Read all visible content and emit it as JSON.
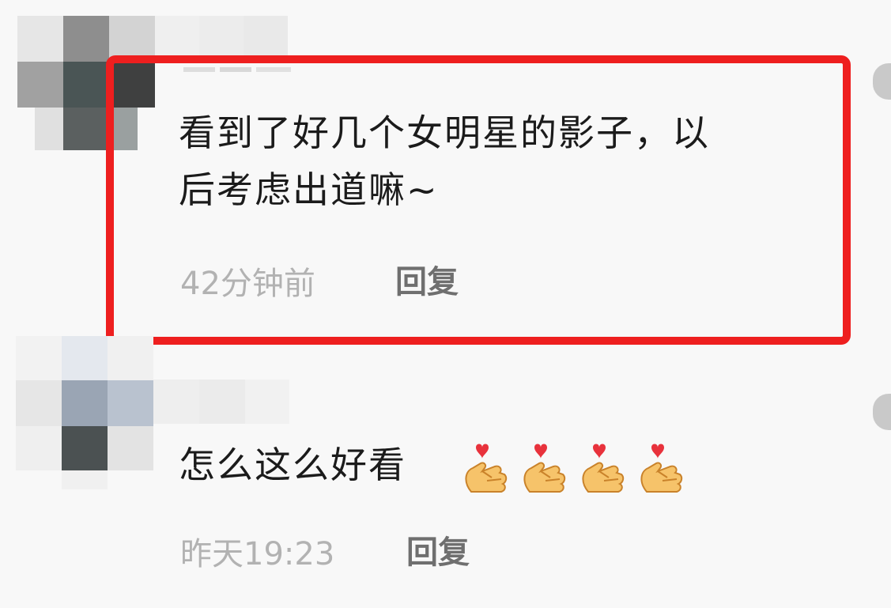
{
  "comments": [
    {
      "text_line1": "看到了好几个女明星的影子，以",
      "text_line2": "后考虑出道嘛~",
      "time": "42分钟前",
      "reply_label": "回复",
      "highlighted": true
    },
    {
      "text": "怎么这么好看",
      "emoji": [
        "finger-heart-icon",
        "finger-heart-icon",
        "finger-heart-icon",
        "finger-heart-icon"
      ],
      "time": "昨天19:23",
      "reply_label": "回复",
      "highlighted": false
    }
  ],
  "colors": {
    "highlight_border": "#ee1f1f",
    "text": "#1b1b1b",
    "time": "#b2b2b2",
    "reply": "#6f6f6f"
  }
}
